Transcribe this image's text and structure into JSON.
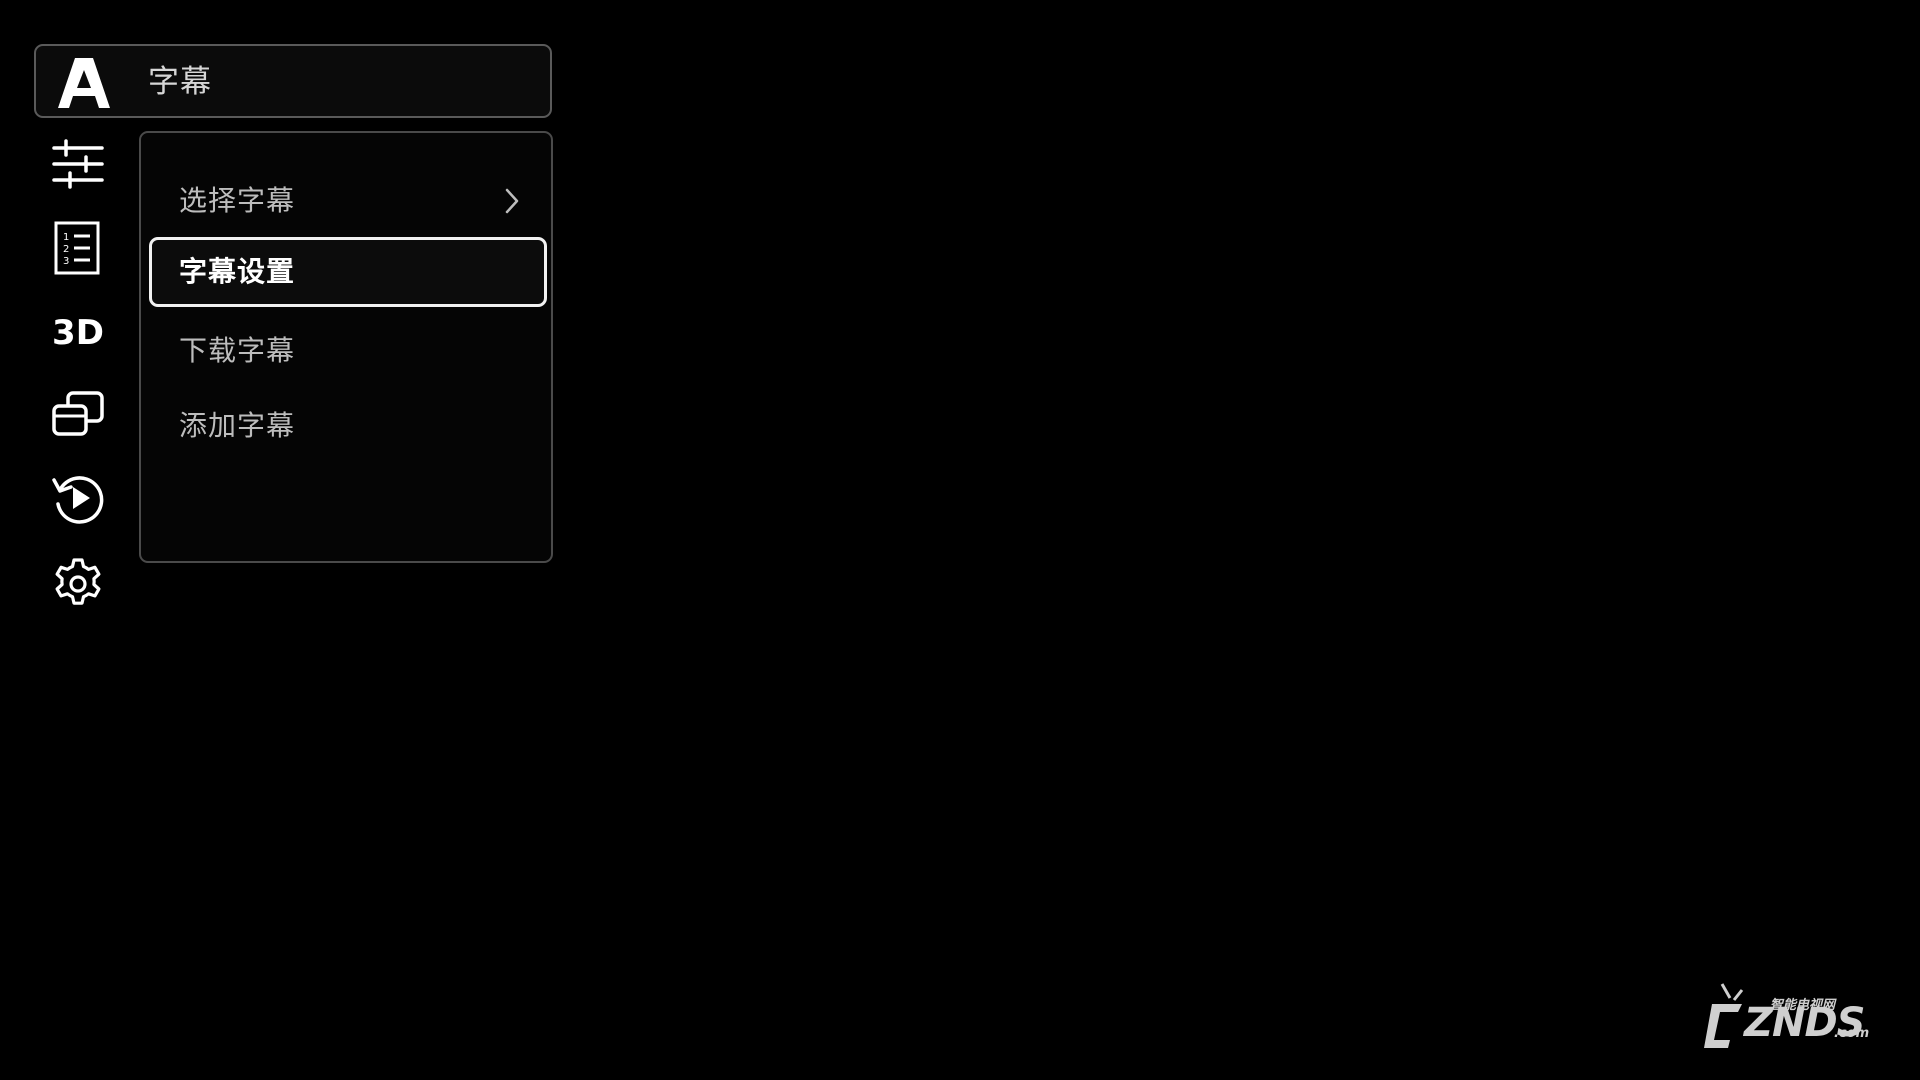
{
  "header": {
    "title": "字幕",
    "icon": "subtitle-a-icon"
  },
  "sidebar": {
    "items": [
      {
        "icon": "sliders-icon"
      },
      {
        "icon": "numbered-list-icon"
      },
      {
        "icon": "3d-icon",
        "text": "3D"
      },
      {
        "icon": "window-switch-icon"
      },
      {
        "icon": "replay-icon"
      },
      {
        "icon": "gear-icon"
      }
    ]
  },
  "submenu": {
    "items": [
      {
        "label": "选择字幕",
        "has_arrow": true
      },
      {
        "label": "字幕设置",
        "selected": true
      },
      {
        "label": "下载字幕"
      },
      {
        "label": "添加字幕"
      }
    ]
  },
  "watermark": {
    "brand": "ZNDS",
    "domain": ".com",
    "tagline": "智能电视网"
  },
  "colors": {
    "background": "#000000",
    "border": "#5a5a5a",
    "selected_border": "#f2f2f2",
    "text": "#bdbdbd"
  }
}
